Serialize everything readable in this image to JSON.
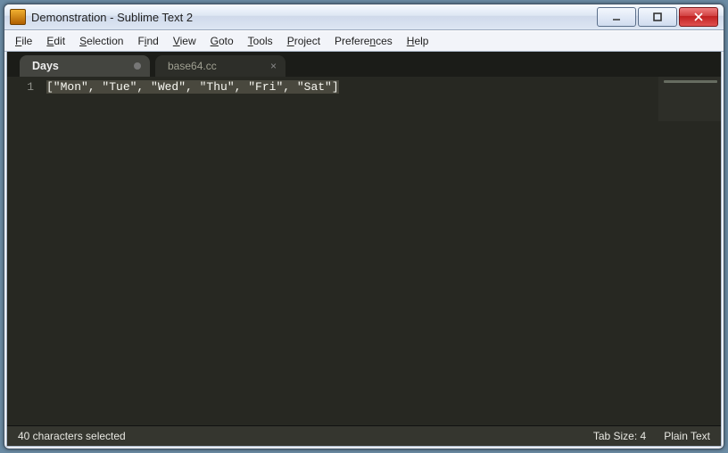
{
  "window": {
    "title": "Demonstration - Sublime Text 2"
  },
  "menu": {
    "items": [
      {
        "pre": "",
        "u": "F",
        "post": "ile"
      },
      {
        "pre": "",
        "u": "E",
        "post": "dit"
      },
      {
        "pre": "",
        "u": "S",
        "post": "election"
      },
      {
        "pre": "F",
        "u": "i",
        "post": "nd"
      },
      {
        "pre": "",
        "u": "V",
        "post": "iew"
      },
      {
        "pre": "",
        "u": "G",
        "post": "oto"
      },
      {
        "pre": "",
        "u": "T",
        "post": "ools"
      },
      {
        "pre": "",
        "u": "P",
        "post": "roject"
      },
      {
        "pre": "Prefere",
        "u": "n",
        "post": "ces"
      },
      {
        "pre": "",
        "u": "H",
        "post": "elp"
      }
    ]
  },
  "tabs": [
    {
      "label": "Days",
      "active": true,
      "dirty": true
    },
    {
      "label": "base64.cc",
      "active": false,
      "dirty": false
    }
  ],
  "editor": {
    "line_number": "1",
    "code_line": "[\"Mon\", \"Tue\", \"Wed\", \"Thu\", \"Fri\", \"Sat\"]"
  },
  "statusbar": {
    "selection": "40 characters selected",
    "tab_size": "Tab Size: 4",
    "syntax": "Plain Text"
  }
}
